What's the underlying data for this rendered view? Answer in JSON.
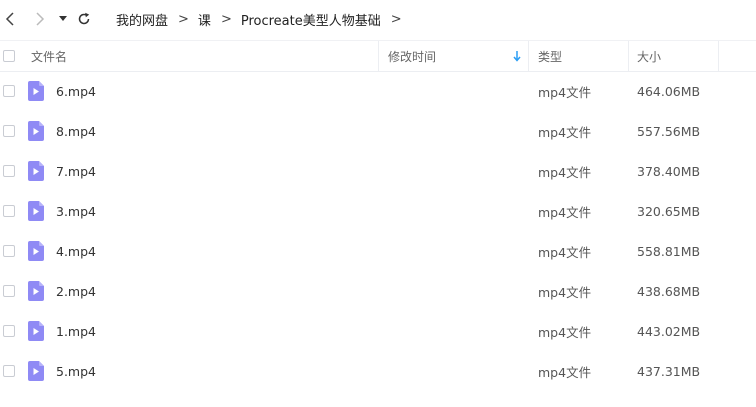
{
  "breadcrumb": {
    "items": [
      "我的网盘",
      "课",
      "Procreate美型人物基础"
    ],
    "separator": ">"
  },
  "icons": {
    "back": "chevron-left-icon",
    "forward": "chevron-right-icon",
    "dropdown": "caret-down-icon",
    "refresh": "refresh-icon",
    "file": "video-file-icon",
    "sort": "sort-down-arrow-icon"
  },
  "colors": {
    "file_icon": "#8f8af5",
    "sort_arrow": "#2a9df4"
  },
  "columns": {
    "name": "文件名",
    "modified": "修改时间",
    "type": "类型",
    "size": "大小"
  },
  "files": [
    {
      "name": "6.mp4",
      "modified": "",
      "type": "mp4文件",
      "size": "464.06MB"
    },
    {
      "name": "8.mp4",
      "modified": "",
      "type": "mp4文件",
      "size": "557.56MB"
    },
    {
      "name": "7.mp4",
      "modified": "",
      "type": "mp4文件",
      "size": "378.40MB"
    },
    {
      "name": "3.mp4",
      "modified": "",
      "type": "mp4文件",
      "size": "320.65MB"
    },
    {
      "name": "4.mp4",
      "modified": "",
      "type": "mp4文件",
      "size": "558.81MB"
    },
    {
      "name": "2.mp4",
      "modified": "",
      "type": "mp4文件",
      "size": "438.68MB"
    },
    {
      "name": "1.mp4",
      "modified": "",
      "type": "mp4文件",
      "size": "443.02MB"
    },
    {
      "name": "5.mp4",
      "modified": "",
      "type": "mp4文件",
      "size": "437.31MB"
    }
  ]
}
